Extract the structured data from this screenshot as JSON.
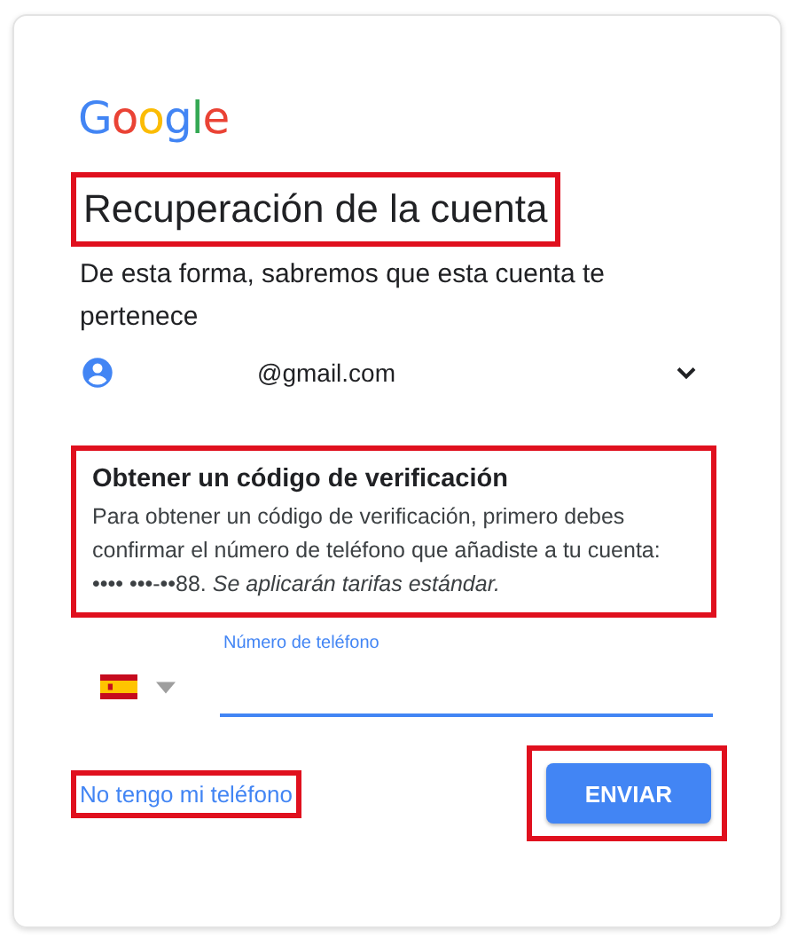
{
  "logo": "Google",
  "title": {
    "text": "Recuperación de la cuenta",
    "highlighted": true
  },
  "subtitle": "De esta forma, sabremos que esta cuenta te pertenece",
  "account": {
    "email": "@gmail.com",
    "expanded": false
  },
  "verification": {
    "highlighted": true,
    "heading": "Obtener un código de verificación",
    "body": "Para obtener un código de verificación, primero debes confirmar el número de teléfono que añadiste a tu cuenta: •••• •••-••88. *Se aplicarán tarifas estándar.*"
  },
  "phone_field": {
    "label": "Número de teléfono",
    "focused": true
  },
  "alt_link": {
    "text": "No tengo mi teléfono",
    "highlighted": true
  },
  "send_button": {
    "text": "ENVIAR",
    "highlighted": true
  }
}
